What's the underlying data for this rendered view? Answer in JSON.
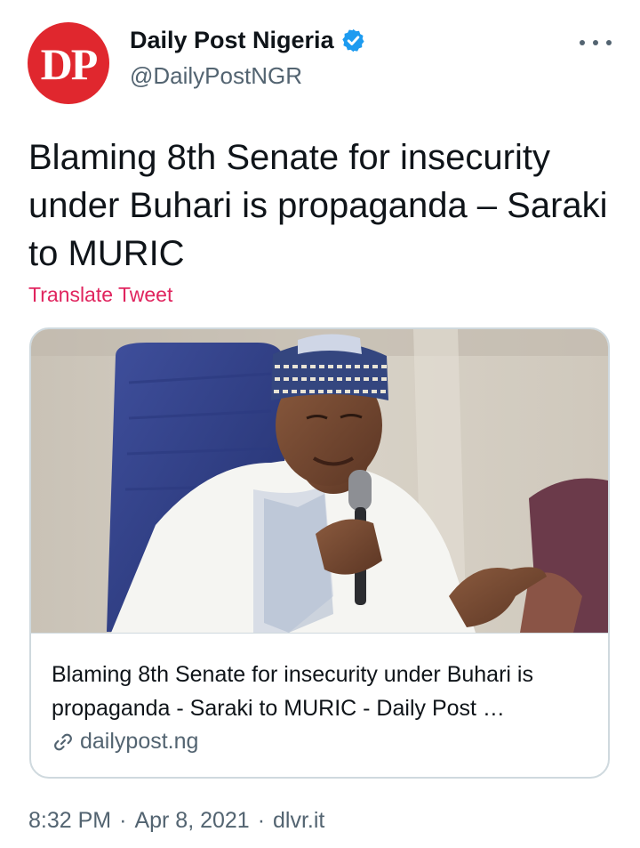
{
  "author": {
    "avatar_text": "DP",
    "display_name": "Daily Post Nigeria",
    "handle": "@DailyPostNGR",
    "verified": true
  },
  "icons": {
    "verified": "verified-badge-icon",
    "more": "more-options-icon",
    "link": "link-icon"
  },
  "tweet": {
    "text": "Blaming 8th Senate for insecurity under Buhari is propaganda – Saraki to MURIC",
    "translate_label": "Translate Tweet"
  },
  "card": {
    "title": "Blaming 8th Senate for insecurity under Buhari is propaganda - Saraki to MURIC - Daily Post …",
    "domain": "dailypost.ng"
  },
  "meta": {
    "time": "8:32 PM",
    "date": "Apr 8, 2021",
    "source": "dlvr.it",
    "separator": "·"
  },
  "colors": {
    "brand_red": "#e0272e",
    "verified_blue": "#1d9bf0",
    "translate_pink": "#e0245e",
    "secondary_text": "#536471",
    "border": "#cfd9de"
  }
}
